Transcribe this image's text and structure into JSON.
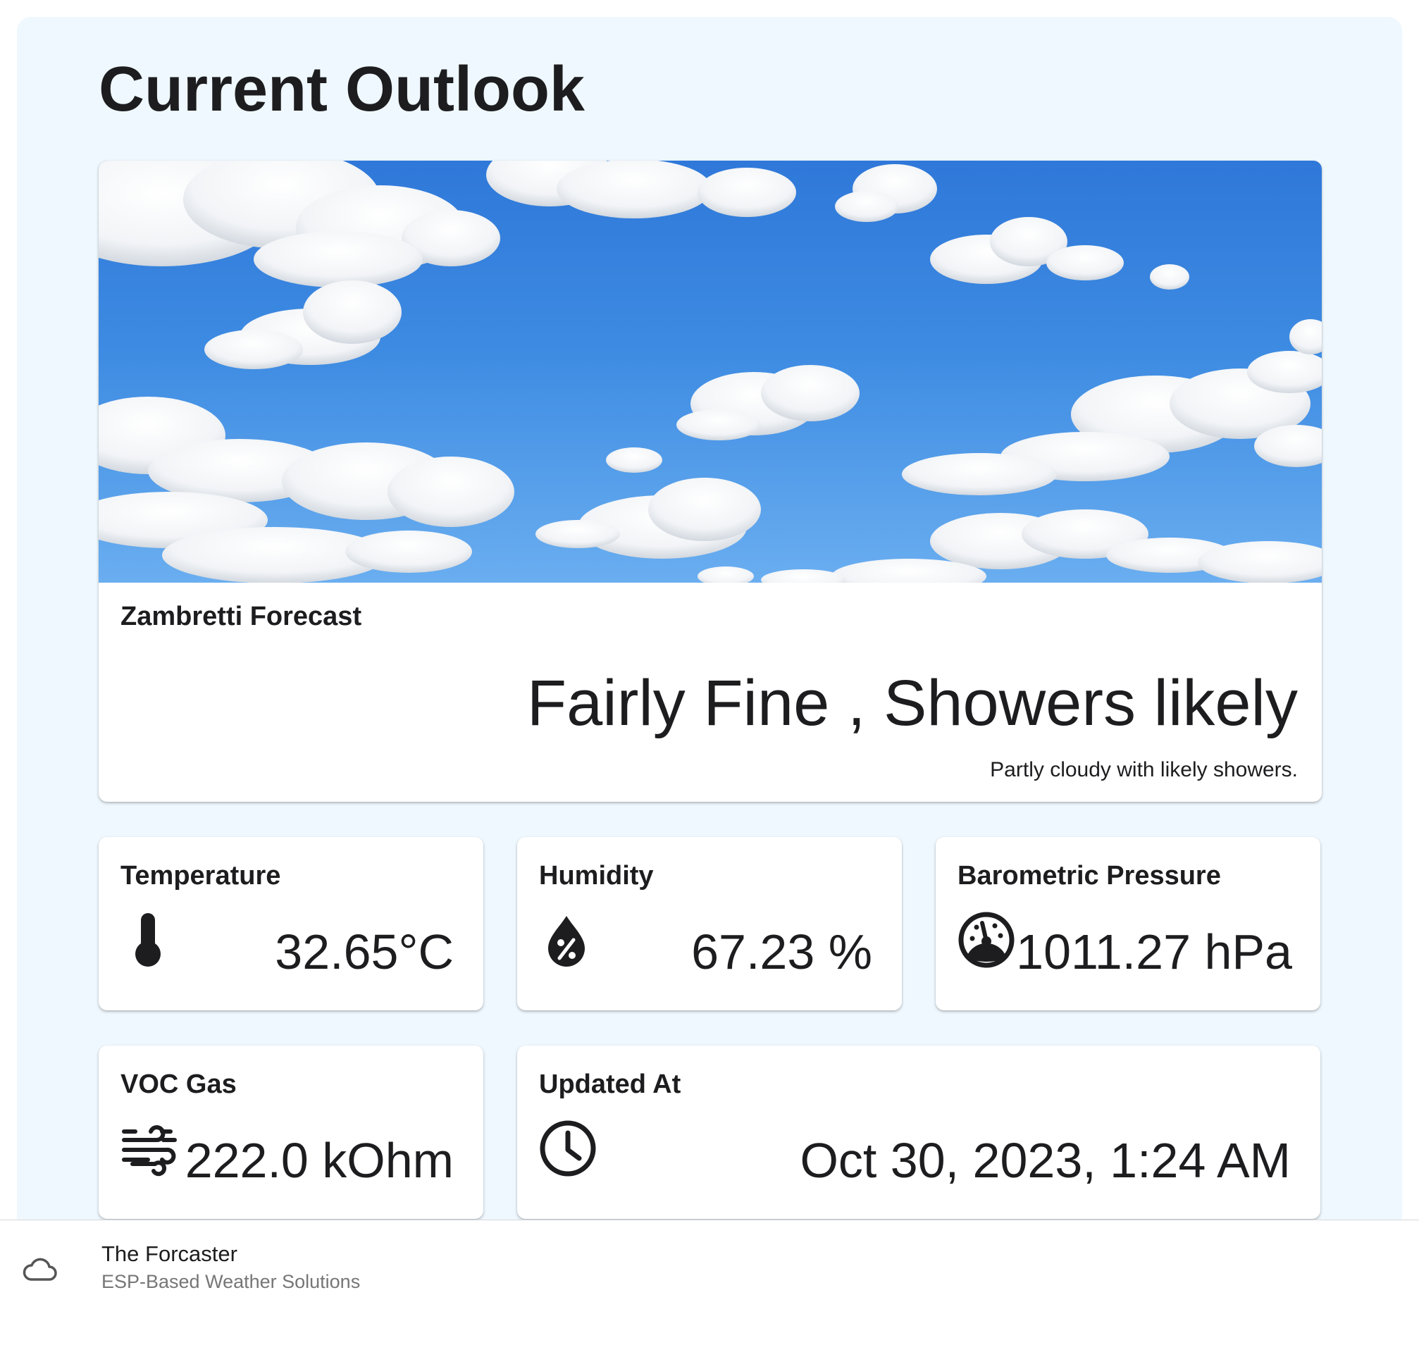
{
  "page": {
    "title": "Current Outlook"
  },
  "forecast": {
    "label": "Zambretti Forecast",
    "value": "Fairly Fine , Showers likely",
    "description": "Partly cloudy with likely showers."
  },
  "metrics": {
    "temperature": {
      "label": "Temperature",
      "value": "32.65°C",
      "icon": "thermometer-icon"
    },
    "humidity": {
      "label": "Humidity",
      "value": "67.23 %",
      "icon": "humidity-drop-icon"
    },
    "pressure": {
      "label": "Barometric Pressure",
      "value": "1011.27 hPa",
      "icon": "gauge-icon"
    },
    "voc": {
      "label": "VOC Gas",
      "value": "222.0 kOhm",
      "icon": "wind-icon"
    },
    "updated": {
      "label": "Updated At",
      "value": "Oct 30, 2023, 1:24 AM",
      "icon": "clock-icon"
    }
  },
  "footer": {
    "title": "The Forcaster",
    "subtitle": "ESP-Based Weather Solutions",
    "icon": "cloud-icon"
  },
  "colors": {
    "panel_background": "#eff8fe",
    "card_background": "#ffffff",
    "text": "#1d1d1f",
    "muted_text": "#767676",
    "sky_blue": "#3d8be2"
  }
}
